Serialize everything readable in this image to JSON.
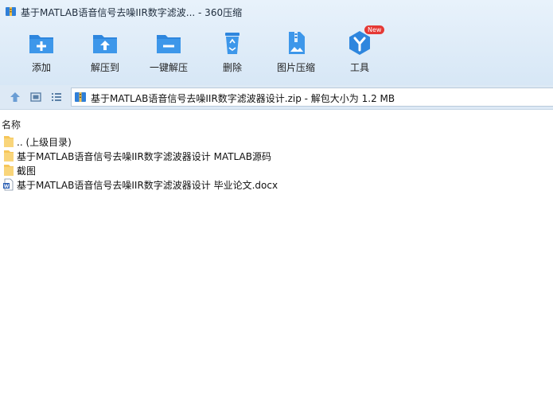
{
  "window": {
    "title": "基于MATLAB语音信号去噪IIR数字滤波... - 360压缩"
  },
  "toolbar": {
    "add": "添加",
    "extract": "解压到",
    "one_click_extract": "一键解压",
    "delete": "删除",
    "image_compress": "图片压缩",
    "tools": "工具",
    "tools_badge": "New"
  },
  "address": {
    "path": "基于MATLAB语音信号去噪IIR数字滤波器设计.zip - 解包大小为 1.2 MB"
  },
  "list": {
    "header_name": "名称",
    "items": [
      {
        "name": ".. (上级目录)",
        "icon": "folder-icon"
      },
      {
        "name": "基于MATLAB语音信号去噪IIR数字滤波器设计 MATLAB源码",
        "icon": "folder-icon"
      },
      {
        "name": "截图",
        "icon": "folder-icon"
      },
      {
        "name": "基于MATLAB语音信号去噪IIR数字滤波器设计 毕业论文.docx",
        "icon": "word-doc-icon"
      }
    ]
  },
  "colors": {
    "accent": "#3a8ee6",
    "folder": "#f6c659",
    "badge": "#e53935"
  }
}
